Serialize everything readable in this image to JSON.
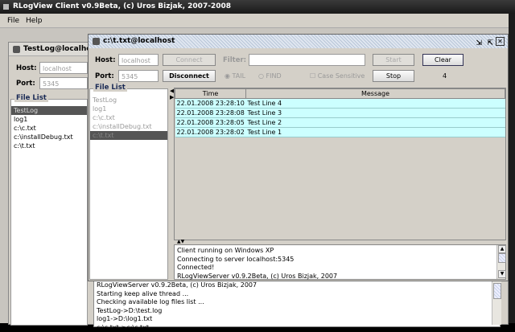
{
  "app": {
    "title": "RLogView Client v0.9Beta, (c) Uros Bizjak, 2007-2008",
    "menu": [
      "File",
      "Help"
    ]
  },
  "back_frame": {
    "title": "TestLog@localhost",
    "host_label": "Host:",
    "host_value": "localhost",
    "port_label": "Port:",
    "port_value": "5345",
    "file_list_title": "File List",
    "files": [
      "TestLog",
      "log1",
      "c:\\c.txt",
      "c:\\installDebug.txt",
      "c:\\t.txt"
    ],
    "selected_file": "TestLog",
    "console": [
      "RLogViewServer v0.9.2Beta, (c) Uros Bizjak, 2007",
      "Starting keep alive thread ...",
      "Checking available log files list ...",
      "TestLog->D:\\test.log",
      "log1->D:\\log1.txt",
      "c:\\c.txt->c:\\c.txt"
    ]
  },
  "front_frame": {
    "title": "c:\\t.txt@localhost",
    "host_label": "Host:",
    "host_value": "localhost",
    "port_label": "Port:",
    "port_value": "5345",
    "connect": "Connect",
    "disconnect": "Disconnect",
    "filter_label": "Filter:",
    "filter_value": "",
    "start": "Start",
    "clear": "Clear",
    "stop": "Stop",
    "tail": "TAIL",
    "find": "FIND",
    "mode": "TAIL",
    "case_sensitive": "Case Sensitive",
    "case_checked": false,
    "count": "4",
    "file_list_title": "File List",
    "files": [
      "TestLog",
      "log1",
      "c:\\c.txt",
      "c:\\installDebug.txt",
      "c:\\t.txt"
    ],
    "selected_file": "c:\\t.txt",
    "columns": [
      "Time",
      "Message"
    ],
    "rows": [
      {
        "time": "22.01.2008 23:28:10",
        "message": "Test Line 4"
      },
      {
        "time": "22.01.2008 23:28:08",
        "message": "Test Line 3"
      },
      {
        "time": "22.01.2008 23:28:05",
        "message": "Test Line 2"
      },
      {
        "time": "22.01.2008 23:28:02",
        "message": "Test Line 1"
      }
    ],
    "console": [
      "Client running on Windows XP",
      "Connecting to server localhost:5345",
      "Connected!",
      "RLogViewServer v0.9.2Beta, (c) Uros Bizjak, 2007"
    ]
  },
  "colors": {
    "row_bg": "#ccffff",
    "selection": "#555555"
  }
}
